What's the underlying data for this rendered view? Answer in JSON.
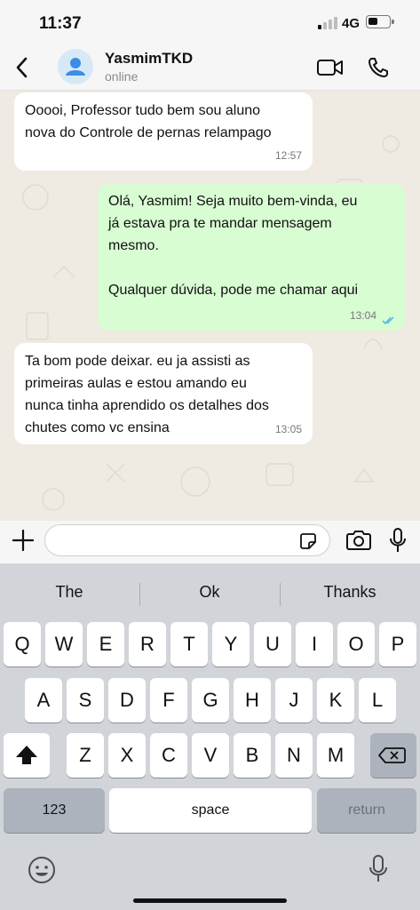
{
  "status_bar": {
    "time": "11:37",
    "network": "4G"
  },
  "header": {
    "contact_name": "YasmimTKD",
    "contact_status": "online",
    "icons": [
      "back-chevron-icon",
      "avatar-person-icon",
      "video-call-icon",
      "phone-icon"
    ]
  },
  "messages": [
    {
      "direction": "incoming",
      "text": "Ooooi, Professor tudo bem sou aluno\nnova do Controle de pernas relampago",
      "time": "12:57"
    },
    {
      "direction": "outgoing",
      "text": "Olá, Yasmim! Seja muito bem-vinda, eu\njá estava pra te mandar mensagem\nmesmo.\n\nQualquer dúvida, pode me chamar aqui",
      "time": "13:04",
      "read": true
    },
    {
      "direction": "incoming",
      "text": "Ta bom pode deixar. eu ja assisti as\nprimeiras aulas e estou amando eu\nnunca tinha aprendido os detalhes dos\nchutes como vc ensina",
      "time": "13:05"
    }
  ],
  "composer": {
    "value": "",
    "placeholder": ""
  },
  "keyboard": {
    "predictions": [
      "The",
      "Ok",
      "Thanks"
    ],
    "row1": [
      "Q",
      "W",
      "E",
      "R",
      "T",
      "Y",
      "U",
      "I",
      "O",
      "P"
    ],
    "row2": [
      "A",
      "S",
      "D",
      "F",
      "G",
      "H",
      "J",
      "K",
      "L"
    ],
    "row3": [
      "Z",
      "X",
      "C",
      "V",
      "B",
      "N",
      "M"
    ],
    "numbers_label": "123",
    "space_label": "space",
    "return_label": "return"
  },
  "colors": {
    "outgoing_bubble": "#d9fdd3",
    "incoming_bubble": "#ffffff",
    "chat_background": "#efeae2",
    "read_ticks": "#53bdeb",
    "avatar_accent": "#3a8ee6"
  }
}
